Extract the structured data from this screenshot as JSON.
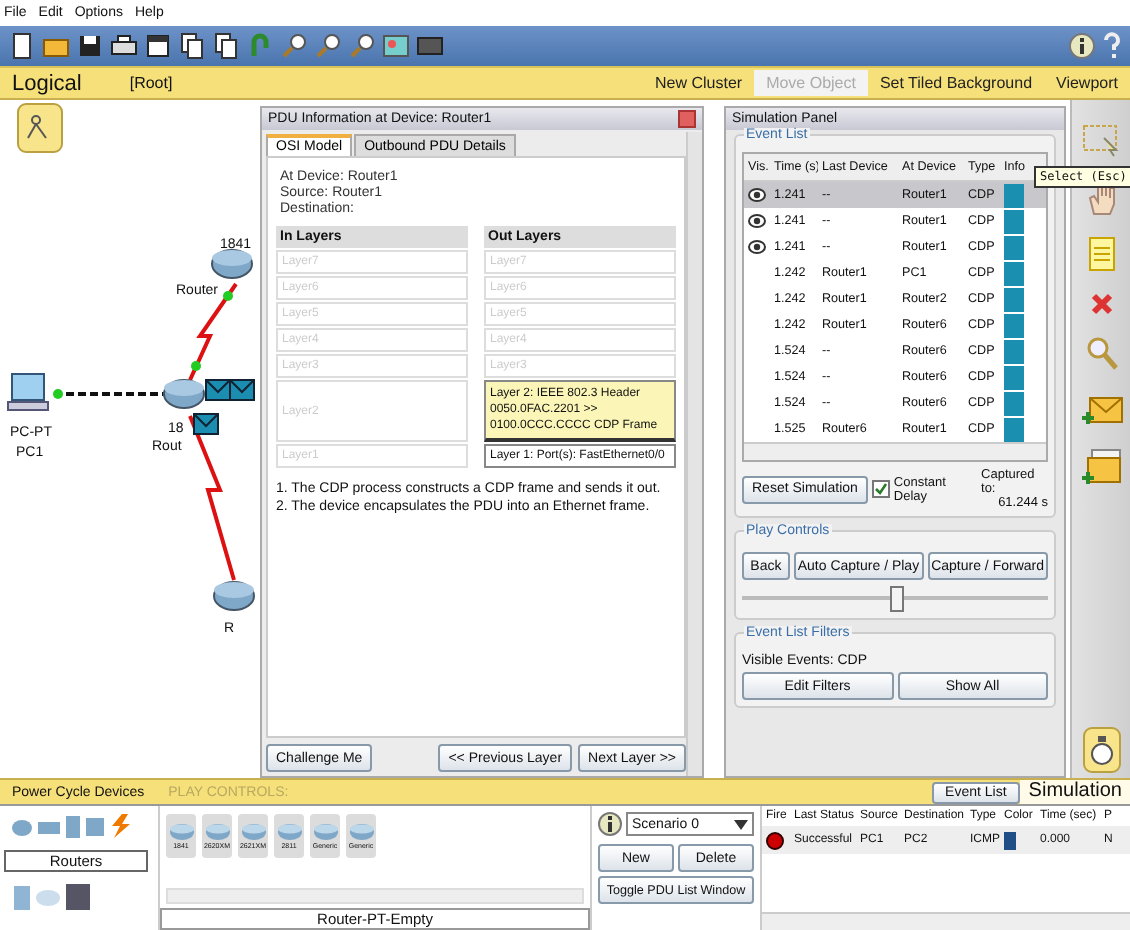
{
  "menu": [
    {
      "label": "File"
    },
    {
      "label": "Edit"
    },
    {
      "label": "Options"
    },
    {
      "label": "Help"
    }
  ],
  "workspace_bar": {
    "view": "Logical",
    "path": "[Root]",
    "actions": [
      {
        "label": "New Cluster",
        "disabled": false
      },
      {
        "label": "Move Object",
        "disabled": true
      },
      {
        "label": "Set Tiled Background",
        "disabled": false
      },
      {
        "label": "Viewport",
        "disabled": false
      }
    ]
  },
  "topology": {
    "devices": [
      {
        "kind": "router",
        "model": "1841",
        "name": "Router"
      },
      {
        "kind": "pc",
        "model": "PC-PT",
        "name": "PC1"
      },
      {
        "kind": "router",
        "model": "18",
        "name": "Rout"
      },
      {
        "kind": "router",
        "name": "R"
      }
    ]
  },
  "pdu_window": {
    "title": "PDU Information at Device: Router1",
    "tabs": [
      {
        "label": "OSI Model",
        "selected": true
      },
      {
        "label": "Outbound PDU Details",
        "selected": false
      }
    ],
    "info": [
      "At Device: Router1",
      "Source: Router1",
      "Destination:"
    ],
    "in_heading": "In Layers",
    "out_heading": "Out Layers",
    "in_layers": [
      {
        "text": "Layer7",
        "active": false
      },
      {
        "text": "Layer6",
        "active": false
      },
      {
        "text": "Layer5",
        "active": false
      },
      {
        "text": "Layer4",
        "active": false
      },
      {
        "text": "Layer3",
        "active": false
      },
      {
        "text": "Layer2",
        "active": false
      },
      {
        "text": "Layer1",
        "active": false
      }
    ],
    "out_layers": [
      {
        "text": "Layer7",
        "active": false,
        "selected": false
      },
      {
        "text": "Layer6",
        "active": false,
        "selected": false
      },
      {
        "text": "Layer5",
        "active": false,
        "selected": false
      },
      {
        "text": "Layer4",
        "active": false,
        "selected": false
      },
      {
        "text": "Layer3",
        "active": false,
        "selected": false
      },
      {
        "text": "Layer 2: IEEE 802.3 Header 0050.0FAC.2201 >> 0100.0CCC.CCCC CDP Frame",
        "active": true,
        "selected": true
      },
      {
        "text": "Layer 1: Port(s): FastEthernet0/0",
        "active": true,
        "selected": false
      }
    ],
    "description": [
      "1. The CDP process constructs a CDP frame and sends it out.",
      "2. The device encapsulates the PDU into an Ethernet frame."
    ],
    "buttons": {
      "challenge": "Challenge Me",
      "previous": "<< Previous Layer",
      "next": "Next Layer >>"
    }
  },
  "simulation_panel": {
    "title": "Simulation Panel",
    "event_list": {
      "legend": "Event List",
      "columns": [
        "Vis.",
        "Time (s)",
        "Last Device",
        "At Device",
        "Type",
        "Info"
      ],
      "rows": [
        {
          "visible": true,
          "selected": true,
          "time": "1.241",
          "last_device": "--",
          "at_device": "Router1",
          "type": "CDP"
        },
        {
          "visible": true,
          "selected": false,
          "time": "1.241",
          "last_device": "--",
          "at_device": "Router1",
          "type": "CDP"
        },
        {
          "visible": true,
          "selected": false,
          "time": "1.241",
          "last_device": "--",
          "at_device": "Router1",
          "type": "CDP"
        },
        {
          "visible": false,
          "selected": false,
          "time": "1.242",
          "last_device": "Router1",
          "at_device": "PC1",
          "type": "CDP"
        },
        {
          "visible": false,
          "selected": false,
          "time": "1.242",
          "last_device": "Router1",
          "at_device": "Router2",
          "type": "CDP"
        },
        {
          "visible": false,
          "selected": false,
          "time": "1.242",
          "last_device": "Router1",
          "at_device": "Router6",
          "type": "CDP"
        },
        {
          "visible": false,
          "selected": false,
          "time": "1.524",
          "last_device": "--",
          "at_device": "Router6",
          "type": "CDP"
        },
        {
          "visible": false,
          "selected": false,
          "time": "1.524",
          "last_device": "--",
          "at_device": "Router6",
          "type": "CDP"
        },
        {
          "visible": false,
          "selected": false,
          "time": "1.524",
          "last_device": "--",
          "at_device": "Router6",
          "type": "CDP"
        },
        {
          "visible": false,
          "selected": false,
          "time": "1.525",
          "last_device": "Router6",
          "at_device": "Router1",
          "type": "CDP"
        }
      ],
      "reset": "Reset Simulation",
      "constant_delay": {
        "label": "Constant Delay",
        "checked": true
      },
      "captured_label": "Captured to:",
      "captured_value": "61.244 s"
    },
    "play_controls": {
      "legend": "Play Controls",
      "buttons": [
        "Back",
        "Auto Capture / Play",
        "Capture / Forward"
      ],
      "speed": {
        "level": 0.5
      }
    },
    "filters": {
      "legend": "Event List Filters",
      "visible_events": "Visible Events:  CDP",
      "buttons": [
        "Edit Filters",
        "Show All"
      ]
    }
  },
  "tooltip": "Select (Esc)",
  "bottom_bar": {
    "power_cycle": "Power Cycle Devices",
    "play_controls": "PLAY CONTROLS:",
    "event_list": "Event List",
    "mode": "Simulation"
  },
  "device_panel": {
    "category": "Routers",
    "models": [
      "1841",
      "2620XM",
      "2621XM",
      "2811",
      "Generic",
      "Generic"
    ],
    "selected_model": "Router-PT-Empty"
  },
  "scenario": {
    "value": "Scenario 0",
    "buttons": [
      "New",
      "Delete"
    ],
    "toggle": "Toggle PDU List Window"
  },
  "pdu_list": {
    "columns": [
      "Fire",
      "Last Status",
      "Source",
      "Destination",
      "Type",
      "Color",
      "Time (sec)",
      "P"
    ],
    "rows": [
      {
        "last_status": "Successful",
        "source": "PC1",
        "destination": "PC2",
        "type": "ICMP",
        "color": "#1f4f86",
        "time": "0.000",
        "column_8": "N"
      }
    ]
  }
}
